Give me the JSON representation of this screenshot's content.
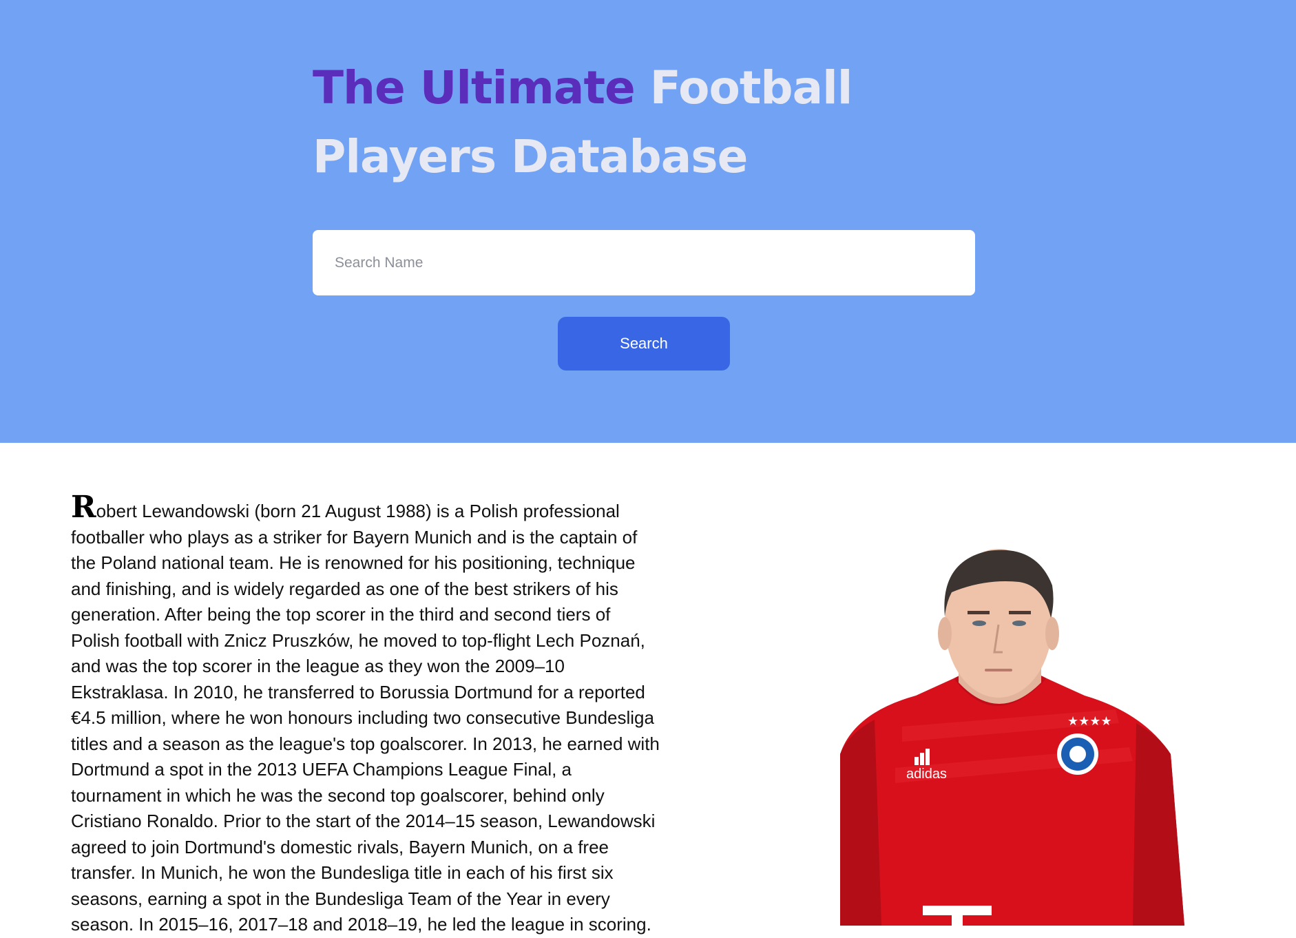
{
  "header": {
    "title_accent": "The Ultimate",
    "title_rest": " Football Players Database"
  },
  "search": {
    "placeholder": "Search Name",
    "value": "",
    "button_label": "Search"
  },
  "bio": {
    "drop_cap": "R",
    "text": "obert Lewandowski (born 21 August 1988) is a Polish professional footballer who plays as a striker for Bayern Munich and is the captain of the Poland national team. He is renowned for his positioning, technique and finishing, and is widely regarded as one of the best strikers of his generation. After being the top scorer in the third and second tiers of Polish football with Znicz Pruszków, he moved to top-flight Lech Poznań, and was the top scorer in the league as they won the 2009–10 Ekstraklasa. In 2010, he transferred to Borussia Dortmund for a reported €4.5 million, where he won honours including two consecutive Bundesliga titles and a season as the league's top goalscorer. In 2013, he earned with Dortmund a spot in the 2013 UEFA Champions League Final, a tournament in which he was the second top goalscorer, behind only Cristiano Ronaldo. Prior to the start of the 2014–15 season, Lewandowski agreed to join Dortmund's domestic rivals, Bayern Munich, on a free transfer. In Munich, he won the Bundesliga title in each of his first six seasons, earning a spot in the Bundesliga Team of the Year in every season. In 2015–16, 2017–18 and 2018–19, he led the league in scoring."
  },
  "photo": {
    "shirt_brand": "adidas",
    "shirt_color": "#dc0f1d",
    "background": "#ffffff"
  }
}
